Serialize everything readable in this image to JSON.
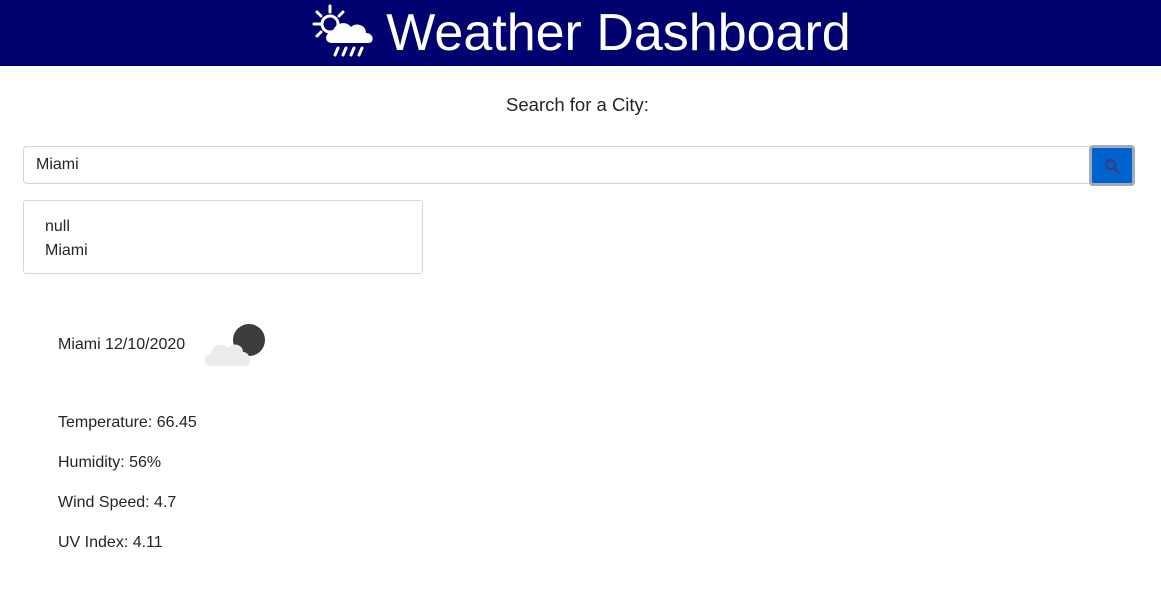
{
  "header": {
    "title": "Weather Dashboard",
    "logo_icon": "sun-cloud-rain-icon",
    "background_color": "#01016f"
  },
  "search": {
    "heading": "Search for a City:",
    "input_value": "Miami",
    "button_icon": "search-icon",
    "button_color": "#0062cc"
  },
  "history": {
    "items": [
      "null",
      "Miami"
    ]
  },
  "current": {
    "city_date": "Miami 12/10/2020",
    "icon": "night-cloudy-icon",
    "temperature": "Temperature: 66.45",
    "humidity": "Humidity: 56%",
    "wind_speed": "Wind Speed: 4.7",
    "uv_index": "UV Index: 4.11"
  }
}
